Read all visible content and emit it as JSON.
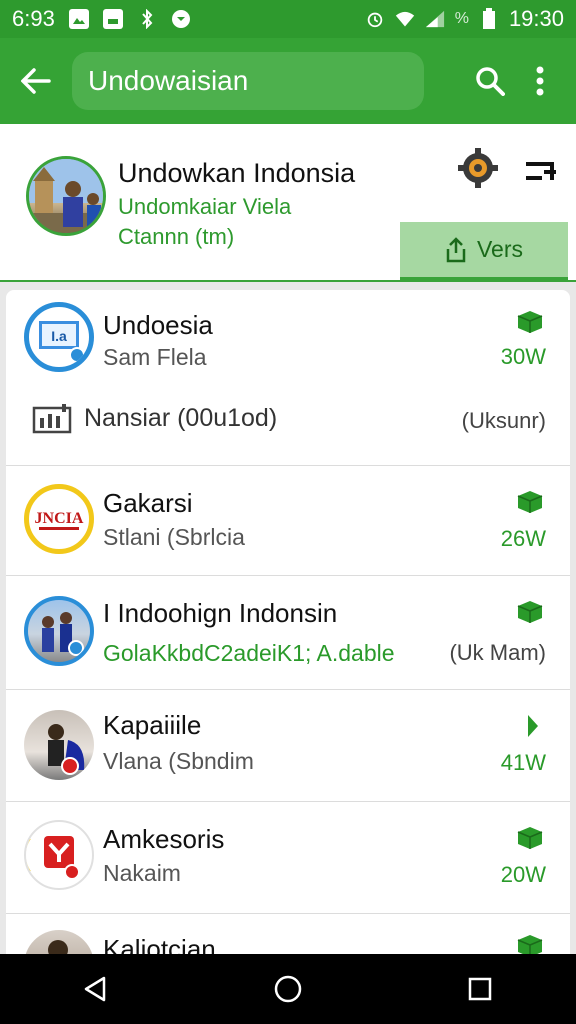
{
  "status_bar": {
    "time_left": "6:93",
    "time": "19:30",
    "battery_percent": "%",
    "icons": [
      "image-icon",
      "cast-icon",
      "bluetooth-icon",
      "shield-icon",
      "alarm-icon",
      "wifi-icon",
      "signal-icon",
      "battery-icon"
    ]
  },
  "app_bar": {
    "search_text": "Undowaisian",
    "icons": [
      "back-arrow-icon",
      "search-icon",
      "more-vert-icon"
    ]
  },
  "profile": {
    "name": "Undowkan Indonsia",
    "subtitle": "Undomkaiar Viela",
    "subtitle2": "Ctannn (tm)",
    "vers_button": "Vers"
  },
  "list": [
    {
      "title": "Undoesia",
      "subtitle": "Sam Flela",
      "value": "30W",
      "badge": "box"
    },
    {
      "title": "Gakarsi",
      "subtitle": "Stlani (Sbrlcia",
      "value": "26W",
      "badge": "box"
    },
    {
      "title": "I Indoohign Indonsin",
      "subtitle": "GolaKkbdC2adeiK1; A.dable",
      "value": "(Uk Mam)",
      "badge": "box"
    },
    {
      "title": "Kapaiiile",
      "subtitle": "Vlana (Sbndim",
      "value": "41W",
      "badge": "play"
    },
    {
      "title": "Amkesoris",
      "subtitle": "Nakaim",
      "value": "20W",
      "badge": "box"
    },
    {
      "title": "Kaljotcian",
      "subtitle": "",
      "value": "",
      "badge": "box"
    }
  ],
  "extra_row": {
    "label": "Nansiar (00u1od)",
    "value": "(Uksunr)"
  },
  "avatar_logo_text": {
    "item1": "I.a",
    "item2": "JNCIA"
  },
  "colors": {
    "primary": "#35a335",
    "status_bar": "#2e9a2e",
    "accent_text": "#2a9a2a",
    "vers_bg": "#a6d8a2"
  }
}
